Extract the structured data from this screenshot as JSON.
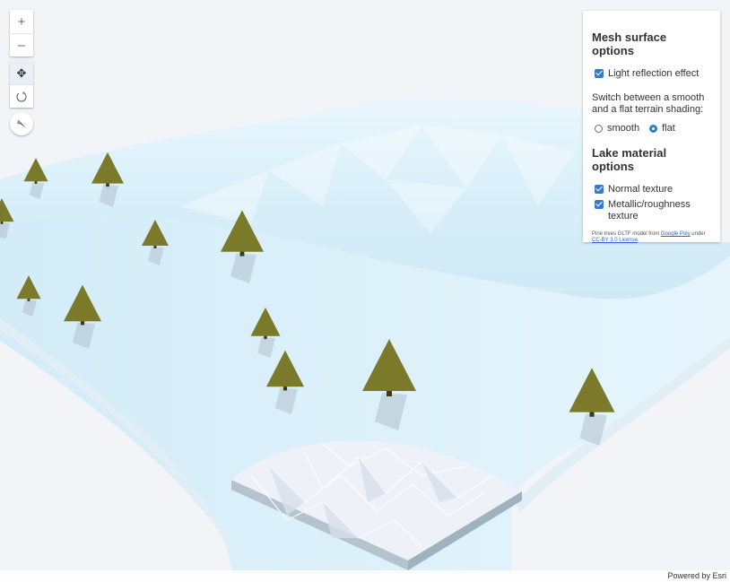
{
  "navigation": {
    "zoom_in_symbol": "+",
    "zoom_out_symbol": "–",
    "pan_symbol": "✥",
    "rotate_symbol": "⟳"
  },
  "panel": {
    "mesh_title": "Mesh surface options",
    "light_reflection_label": "Light reflection effect",
    "light_reflection_checked": true,
    "shading_description": "Switch between a smooth and a flat terrain shading:",
    "shading_options": [
      "smooth",
      "flat"
    ],
    "shading_selected": "flat",
    "lake_title": "Lake material options",
    "normal_texture_label": "Normal texture",
    "normal_texture_checked": true,
    "metallic_label": "Metallic/roughness texture",
    "metallic_checked": true,
    "credit_prefix": "Pine trees GLTF model from ",
    "credit_link1": "Google Poly",
    "credit_middle": " under ",
    "credit_link2": "CC-BY 3.0 License",
    "credit_suffix": "."
  },
  "attribution": "Powered by Esri",
  "colors": {
    "accent": "#2f7bd6",
    "terrain": "#dff1fb",
    "tree_foliage": "#6b6b23",
    "tree_trunk": "#3d3a18",
    "lake": "#e9ecf4"
  }
}
